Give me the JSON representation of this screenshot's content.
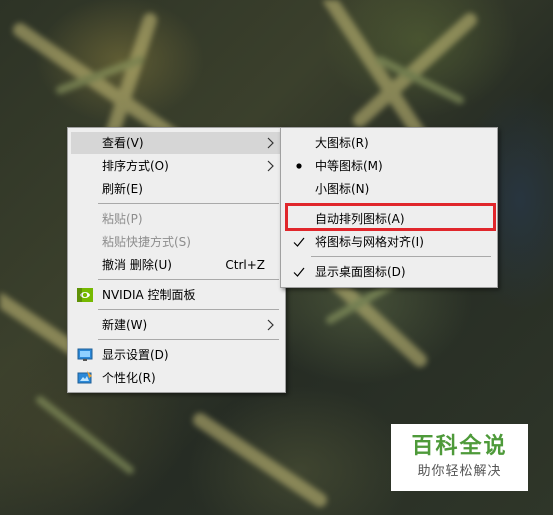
{
  "context_menu": {
    "items": [
      {
        "label": "查看(V)"
      },
      {
        "label": "排序方式(O)"
      },
      {
        "label": "刷新(E)"
      },
      {
        "label": "粘贴(P)"
      },
      {
        "label": "粘贴快捷方式(S)"
      },
      {
        "label": "撤消 删除(U)",
        "shortcut": "Ctrl+Z"
      },
      {
        "label": "NVIDIA 控制面板",
        "icon": "nvidia-icon"
      },
      {
        "label": "新建(W)"
      },
      {
        "label": "显示设置(D)",
        "icon": "display-settings-icon"
      },
      {
        "label": "个性化(R)",
        "icon": "personalize-icon"
      }
    ]
  },
  "view_submenu": {
    "items": [
      {
        "label": "大图标(R)"
      },
      {
        "label": "中等图标(M)",
        "mark": "bullet"
      },
      {
        "label": "小图标(N)"
      },
      {
        "label": "自动排列图标(A)"
      },
      {
        "label": "将图标与网格对齐(I)",
        "mark": "check"
      },
      {
        "label": "显示桌面图标(D)",
        "mark": "check"
      }
    ]
  },
  "highlight_color": "#e0262b",
  "watermark": {
    "title": "百科全说",
    "subtitle": "助你轻松解决",
    "color": "#4e9a3a"
  }
}
